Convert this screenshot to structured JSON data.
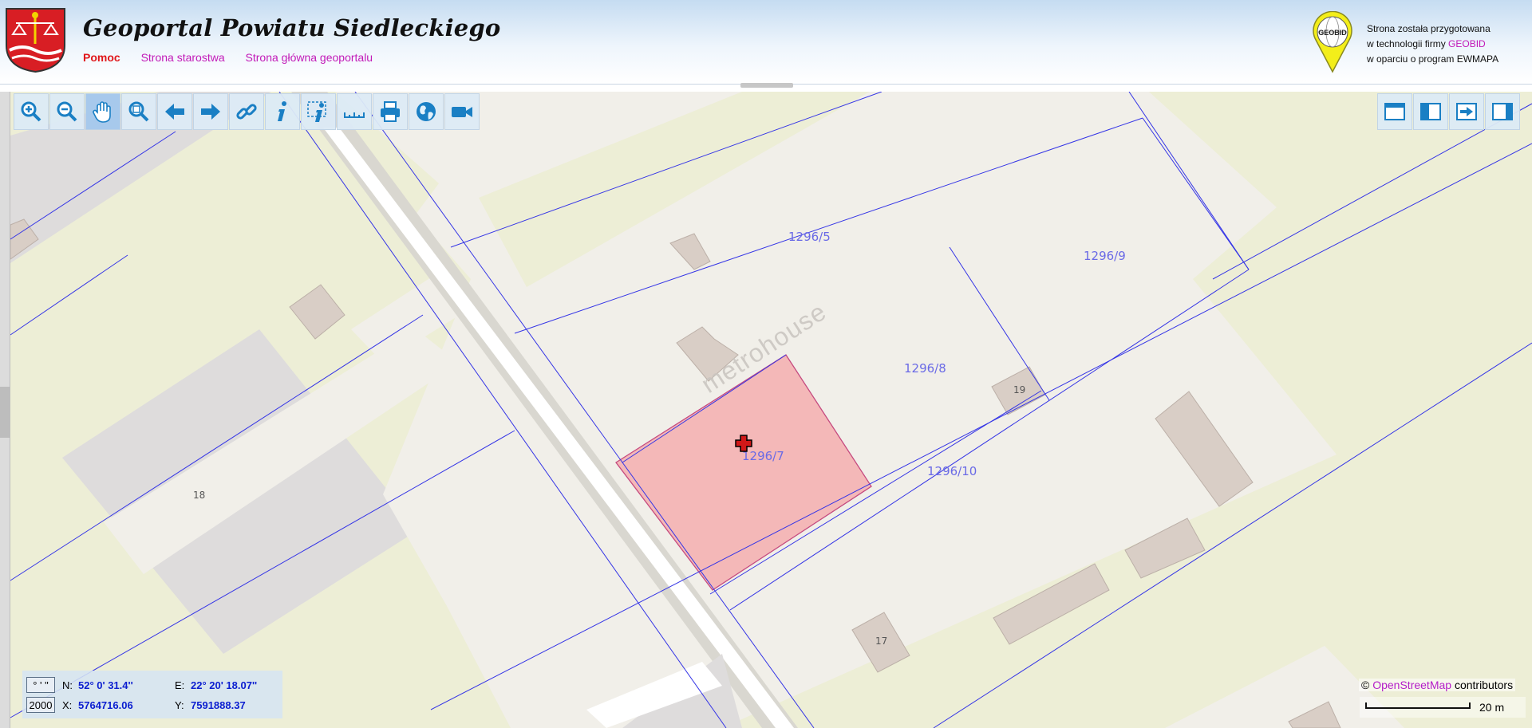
{
  "header": {
    "title": "Geoportal Powiatu Siedleckiego",
    "links": [
      "Pomoc",
      "Strona starostwa",
      "Strona główna geoportalu"
    ],
    "geobid": {
      "logo_text": "GEOBID",
      "line1": "Strona została przygotowana",
      "line2_prefix": "w technologii firmy ",
      "line2_brand": "GEOBID",
      "line3": "w oparciu o program EWMAPA"
    }
  },
  "toolbar": {
    "tools": [
      "zoom-in-icon",
      "zoom-out-icon",
      "pan-hand-icon",
      "zoom-extent-icon",
      "back-arrow-icon",
      "forward-arrow-icon",
      "link-icon",
      "info-icon",
      "info-area-icon",
      "measure-ruler-icon",
      "print-icon",
      "globe-icon",
      "camera-icon"
    ],
    "active": "pan-hand-icon",
    "right_tools": [
      "layout-top-icon",
      "layout-left-icon",
      "export-icon",
      "layout-right-icon"
    ]
  },
  "map": {
    "parcels": [
      "1296/5",
      "1296/9",
      "1296/8",
      "1296/7",
      "1296/10"
    ],
    "house_numbers": [
      "18",
      "19",
      "17"
    ],
    "watermark": "metrohouse",
    "selected_parcel": "1296/7",
    "colors": {
      "selected_fill": "#f4b8b8",
      "parcel_lines": "#3535e6",
      "land": "#edeed6"
    }
  },
  "coordinates": {
    "format_label": "° ' \"",
    "n_label": "N:",
    "n_value": "52° 0' 31.4''",
    "e_label": "E:",
    "e_value": "22° 20' 18.07''",
    "system_label": "2000",
    "x_label": "X:",
    "x_value": "5764716.06",
    "y_label": "Y:",
    "y_value": "7591888.37"
  },
  "attribution": {
    "prefix": "© ",
    "link": "OpenStreetMap",
    "suffix": " contributors"
  },
  "scale": {
    "label": "20 m"
  }
}
